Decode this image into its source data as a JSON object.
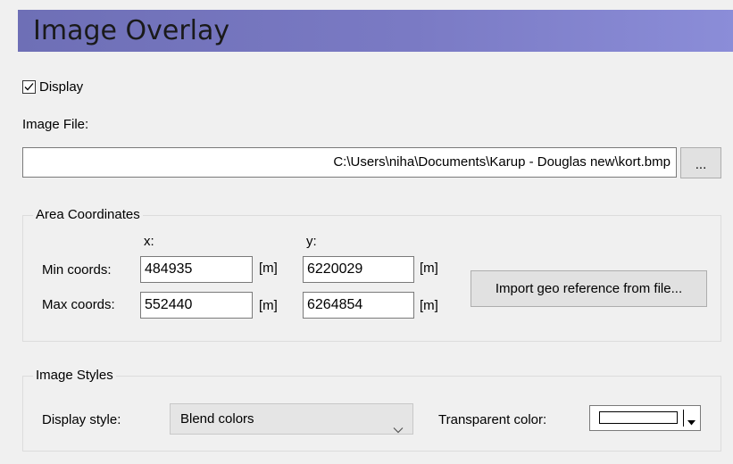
{
  "panel": {
    "title": "Image Overlay"
  },
  "display": {
    "label": "Display",
    "checked": true
  },
  "image_file": {
    "label": "Image File:",
    "value": "C:\\Users\\niha\\Documents\\Karup - Douglas new\\kort.bmp",
    "browse_label": "..."
  },
  "area_coordinates": {
    "group_title": "Area Coordinates",
    "x_header": "x:",
    "y_header": "y:",
    "min_label": "Min coords:",
    "max_label": "Max coords:",
    "unit": "[m]",
    "min_x": "484935",
    "min_y": "6220029",
    "max_x": "552440",
    "max_y": "6264854",
    "import_button": "Import geo reference from file..."
  },
  "image_styles": {
    "group_title": "Image Styles",
    "display_style_label": "Display style:",
    "display_style_value": "Blend colors",
    "transparent_color_label": "Transparent color:",
    "transparent_color_value": "#ffffff"
  },
  "icons": {
    "checkbox": "check-icon",
    "dropdown": "chevron-down-icon",
    "color_dropdown": "triangle-down-icon"
  },
  "colors": {
    "title_gradient_start": "#6e6fb6",
    "title_gradient_end": "#8b8dd8",
    "background": "#f0f0f0"
  }
}
